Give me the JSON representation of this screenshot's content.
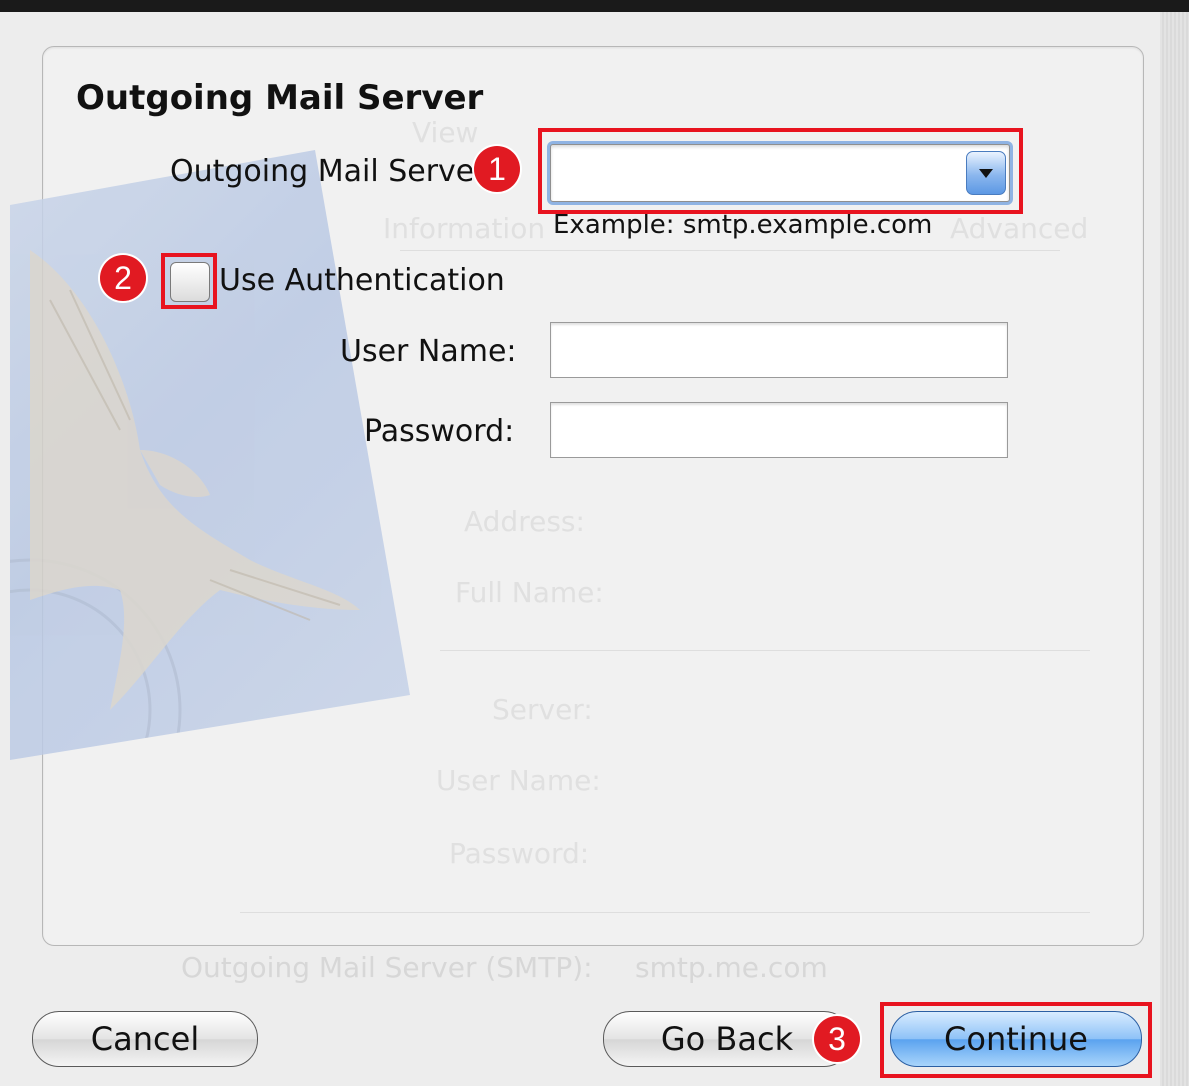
{
  "section_title": "Outgoing Mail Server",
  "outgoing_server": {
    "label": "Outgoing Mail Server:",
    "value": "",
    "example": "Example: smtp.example.com"
  },
  "authentication": {
    "label": "Use Authentication",
    "checked": false
  },
  "user_name": {
    "label": "User Name:",
    "value": ""
  },
  "password": {
    "label": "Password:",
    "value": ""
  },
  "buttons": {
    "cancel": "Cancel",
    "go_back": "Go Back",
    "continue": "Continue"
  },
  "annotations": {
    "step1": "1",
    "step2": "2",
    "step3": "3",
    "color": "#e11a22"
  },
  "background_ghost": {
    "items": [
      "View",
      "Information",
      "Advanced",
      "Address:",
      "Full Name:",
      "Server:",
      "User Name:",
      "Password:",
      "Outgoing Mail Server (SMTP):",
      "smtp.me.com"
    ]
  }
}
